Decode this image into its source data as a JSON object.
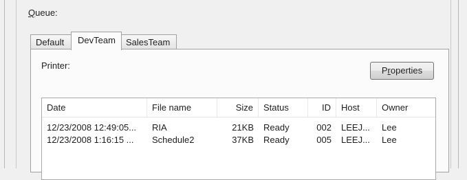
{
  "queue": {
    "mnemonic": "Q",
    "label_rest": "ueue:"
  },
  "tabs": [
    {
      "label": "Default",
      "active": false
    },
    {
      "label": "DevTeam",
      "active": true
    },
    {
      "label": "SalesTeam",
      "active": false
    }
  ],
  "printer_label": "Printer:",
  "properties_button": {
    "before": "P",
    "mnemonic": "r",
    "after": "operties"
  },
  "jobs": {
    "columns": [
      "Date",
      "File name",
      "Size",
      "Status",
      "ID",
      "Host",
      "Owner"
    ],
    "rows": [
      {
        "date": "12/23/2008 12:49:05...",
        "file": "RIA",
        "size": "21KB",
        "status": "Ready",
        "id": "002",
        "host": "LEEJ...",
        "owner": "Lee"
      },
      {
        "date": "12/23/2008 1:16:15 ...",
        "file": "Schedule2",
        "size": "37KB",
        "status": "Ready",
        "id": "005",
        "host": "LEEJ...",
        "owner": "Lee"
      }
    ]
  }
}
